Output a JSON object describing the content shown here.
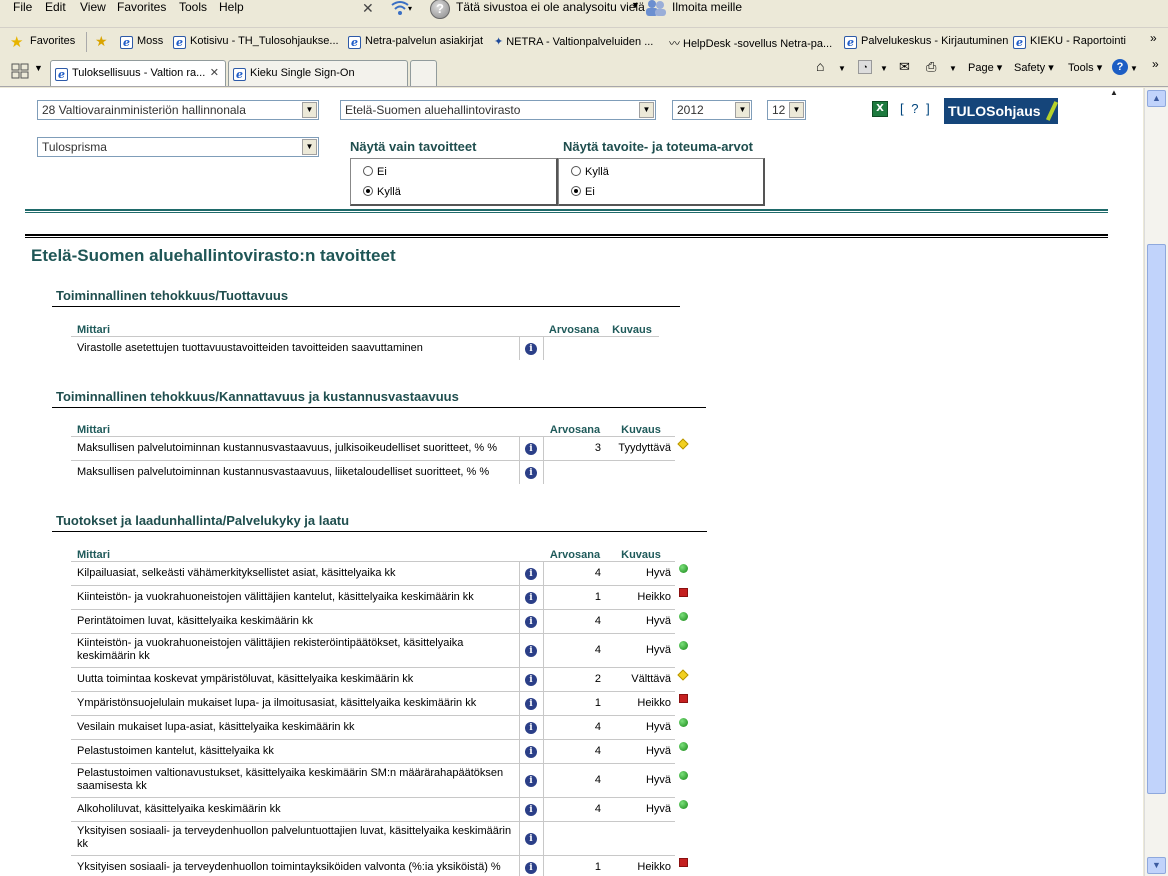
{
  "menu": {
    "file": "File",
    "edit": "Edit",
    "view": "View",
    "favorites": "Favorites",
    "tools": "Tools",
    "help": "Help"
  },
  "toolbar": {
    "phishing_text": "Tätä sivustoa ei ole analysoitu vielä",
    "report_text": "Ilmoita meille"
  },
  "favorites_bar": {
    "label": "Favorites",
    "links": [
      "Moss",
      "Kotisivu - TH_Tulosohjaukse...",
      "Netra-palvelun asiakirjat",
      "NETRA - Valtionpalveluiden ...",
      "HelpDesk -sovellus Netra-pa...",
      "Palvelukeskus - Kirjautuminen",
      "KIEKU - Raportointi"
    ]
  },
  "tabs": {
    "active": "Tuloksellisuus - Valtion ra...",
    "second": "Kieku Single Sign-On"
  },
  "command_bar": {
    "page": "Page",
    "safety": "Safety",
    "tools": "Tools"
  },
  "filters": {
    "ministry": "28 Valtiovarainministeriön hallinnonala",
    "agency": "Etelä-Suomen aluehallintovirasto",
    "year": "2012",
    "month": "12",
    "view": "Tulosprisma",
    "help_link": "[ ? ]",
    "logo": "TULOSohjaus",
    "only_targets_title": "Näytä vain tavoitteet",
    "only_targets_options": [
      "Ei",
      "Kyllä"
    ],
    "target_values_title": "Näytä tavoite- ja toteuma-arvot",
    "target_values_options": [
      "Kyllä",
      "Ei"
    ]
  },
  "page_title": "Etelä-Suomen aluehallintovirasto:n tavoitteet",
  "colors": {
    "green": "#1a8a1a",
    "red": "#c52020",
    "yellow": "#f2d020",
    "heading": "#1f4e4e"
  },
  "sections": [
    {
      "title": "Toiminnallinen tehokkuus/Tuottavuus",
      "headers": {
        "metric": "Mittari",
        "grade": "Arvosana",
        "desc": "Kuvaus"
      },
      "rows": [
        {
          "name": "Virastolle asetettujen tuottavuustavoitteiden tavoitteiden saavuttaminen",
          "grade": "",
          "desc": "",
          "status": ""
        }
      ]
    },
    {
      "title": "Toiminnallinen tehokkuus/Kannattavuus ja kustannusvastaavuus",
      "headers": {
        "metric": "Mittari",
        "grade": "Arvosana",
        "desc": "Kuvaus"
      },
      "rows": [
        {
          "name": "Maksullisen palvelutoiminnan kustannusvastaavuus, julkisoikeudelliset suoritteet, %   %",
          "grade": "3",
          "desc": "Tyydyttävä",
          "status": "yellow"
        },
        {
          "name": "Maksullisen palvelutoiminnan kustannusvastaavuus, liiketaloudelliset suoritteet, %   %",
          "grade": "",
          "desc": "",
          "status": ""
        }
      ]
    },
    {
      "title": "Tuotokset ja laadunhallinta/Palvelukyky ja laatu",
      "headers": {
        "metric": "Mittari",
        "grade": "Arvosana",
        "desc": "Kuvaus"
      },
      "rows": [
        {
          "name": "Kilpailuasiat, selkeästi vähämerkityksellistet asiat, käsittelyaika   kk",
          "grade": "4",
          "desc": "Hyvä",
          "status": "green"
        },
        {
          "name": "Kiinteistön- ja vuokrahuoneistojen välittäjien kantelut, käsittelyaika keskimäärin   kk",
          "grade": "1",
          "desc": "Heikko",
          "status": "red"
        },
        {
          "name": "Perintätoimen luvat, käsittelyaika keskimäärin   kk",
          "grade": "4",
          "desc": "Hyvä",
          "status": "green"
        },
        {
          "name": "Kiinteistön- ja vuokrahuoneistojen välittäjien rekisteröintipäätökset, käsittelyaika keskimäärin   kk",
          "grade": "4",
          "desc": "Hyvä",
          "status": "green"
        },
        {
          "name": "Uutta toimintaa koskevat ympäristöluvat, käsittelyaika keskimäärin   kk",
          "grade": "2",
          "desc": "Välttävä",
          "status": "yellow"
        },
        {
          "name": "Ympäristönsuojelulain mukaiset lupa- ja ilmoitusasiat, käsittelyaika keskimäärin   kk",
          "grade": "1",
          "desc": "Heikko",
          "status": "red"
        },
        {
          "name": "Vesilain mukaiset lupa-asiat, käsittelyaika keskimäärin   kk",
          "grade": "4",
          "desc": "Hyvä",
          "status": "green"
        },
        {
          "name": "Pelastustoimen kantelut, käsittelyaika   kk",
          "grade": "4",
          "desc": "Hyvä",
          "status": "green"
        },
        {
          "name": "Pelastustoimen valtionavustukset, käsittelyaika keskimäärin SM:n määrärahapäätöksen saamisesta   kk",
          "grade": "4",
          "desc": "Hyvä",
          "status": "green"
        },
        {
          "name": "Alkoholiluvat, käsittelyaika keskimäärin   kk",
          "grade": "4",
          "desc": "Hyvä",
          "status": "green"
        },
        {
          "name": "Yksityisen sosiaali- ja terveydenhuollon palveluntuottajien luvat, käsittelyaika keskimäärin   kk",
          "grade": "",
          "desc": "",
          "status": ""
        },
        {
          "name": "Yksityisen sosiaali- ja terveydenhuollon toimintayksiköiden valvonta (%:ia yksiköistä)   %",
          "grade": "1",
          "desc": "Heikko",
          "status": "red"
        }
      ]
    }
  ]
}
